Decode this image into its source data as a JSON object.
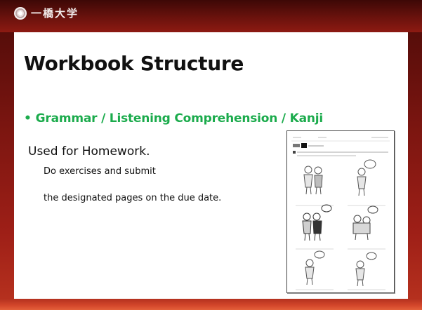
{
  "header": {
    "logo_text": "一橋大学"
  },
  "slide": {
    "title": "Workbook Structure",
    "bullet": {
      "marker": "•",
      "text": "Grammar / Listening Comprehension / Kanji"
    },
    "body": {
      "main": "Used for Homework.",
      "line1": "Do exercises and submit",
      "line2": "the designated pages on the due date."
    }
  },
  "colors": {
    "frame": "#7a1510",
    "bullet_text": "#1bab4c",
    "panel": "#ffffff",
    "title_text": "#111111"
  },
  "icons": {
    "logo": "university-emblem-icon",
    "thumbnail": "workbook-page-icon"
  }
}
